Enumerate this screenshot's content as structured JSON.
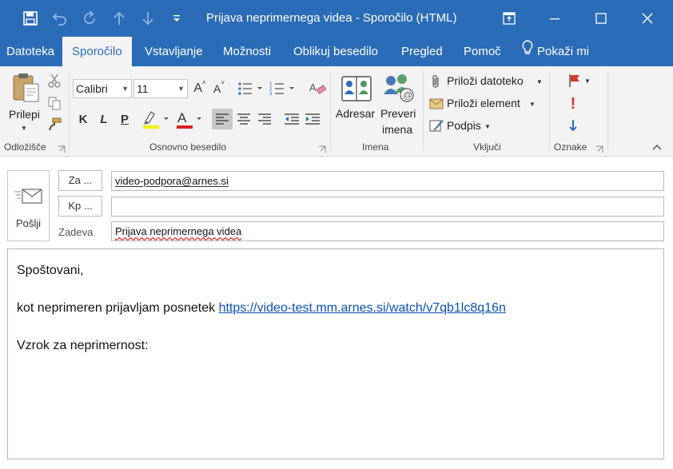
{
  "window": {
    "title": "Prijava neprimernega videa  -  Sporočilo (HTML)"
  },
  "colors": {
    "accent": "#2b6cb8",
    "ribbon_bg": "#f3f3f3",
    "flag_red": "#d9342b",
    "link": "#0b4fb5",
    "font_color_underline": "#e02020",
    "highlight_underline": "#f4f400"
  },
  "tabs": [
    {
      "label": "Datoteka",
      "active": false
    },
    {
      "label": "Sporočilo",
      "active": true
    },
    {
      "label": "Vstavljanje",
      "active": false
    },
    {
      "label": "Možnosti",
      "active": false
    },
    {
      "label": "Oblikuj besedilo",
      "active": false
    },
    {
      "label": "Pregled",
      "active": false
    },
    {
      "label": "Pomoč",
      "active": false
    }
  ],
  "tell_me": {
    "label": "Pokaži mi",
    "icon": "lightbulb-icon"
  },
  "ribbon": {
    "clipboard": {
      "paste_label": "Prilepi",
      "group_label": "Odložišče"
    },
    "basic_text": {
      "font_name": "Calibri",
      "font_size": "11",
      "bold": "K",
      "italic": "L",
      "underline": "P",
      "group_label": "Osnovno besedilo"
    },
    "names": {
      "address_book": "Adresar",
      "check_names_line1": "Preveri",
      "check_names_line2": "imena",
      "group_label": "Imena"
    },
    "include": {
      "attach_file": "Priloži datoteko",
      "attach_item": "Priloži element",
      "signature": "Podpis",
      "group_label": "Vključi"
    },
    "tags": {
      "group_label": "Oznake"
    }
  },
  "compose": {
    "send_label": "Pošlji",
    "to_button": "Za ...",
    "cc_button": "Kp ...",
    "to_value": "video-podpora@arnes.si",
    "cc_value": "",
    "subject_label": "Zadeva",
    "subject_value": "Prijava neprimernega videa",
    "body": {
      "greeting": "Spoštovani,",
      "report_text": "kot neprimeren prijavljam posnetek ",
      "report_link": "https://video-test.mm.arnes.si/watch/v7qb1lc8q16n",
      "reason_label": "Vzrok za neprimernost:"
    }
  }
}
